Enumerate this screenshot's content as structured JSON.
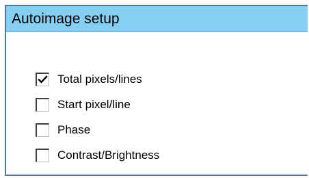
{
  "dialog": {
    "title": "Autoimage setup"
  },
  "options": [
    {
      "label": "Total pixels/lines",
      "checked": true
    },
    {
      "label": "Start pixel/line",
      "checked": false
    },
    {
      "label": "Phase",
      "checked": false
    },
    {
      "label": "Contrast/Brightness",
      "checked": false
    }
  ],
  "colors": {
    "titlebar": "#87cff0",
    "border": "#4a7a9a",
    "background": "#ffffff"
  }
}
